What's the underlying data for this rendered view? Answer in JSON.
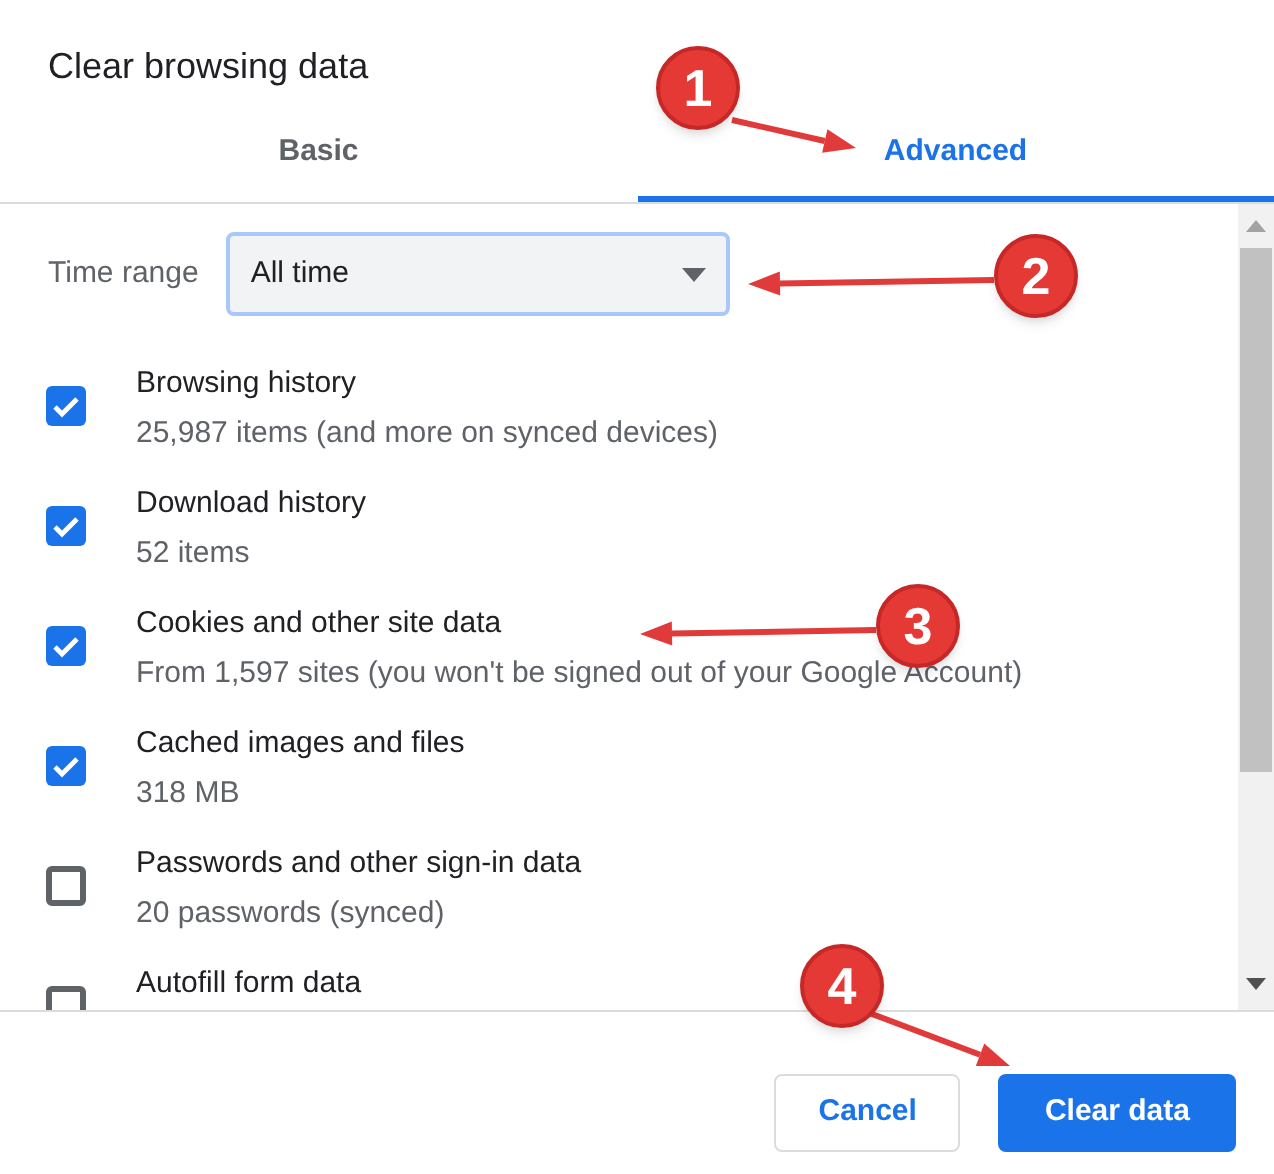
{
  "dialog": {
    "title": "Clear browsing data"
  },
  "tabs": [
    {
      "label": "Basic",
      "selected": false
    },
    {
      "label": "Advanced",
      "selected": true
    }
  ],
  "time_range": {
    "label": "Time range",
    "value": "All time"
  },
  "items": [
    {
      "title": "Browsing history",
      "detail": "25,987 items (and more on synced devices)",
      "checked": true
    },
    {
      "title": "Download history",
      "detail": "52 items",
      "checked": true
    },
    {
      "title": "Cookies and other site data",
      "detail": "From 1,597 sites (you won't be signed out of your Google Account)",
      "checked": true
    },
    {
      "title": "Cached images and files",
      "detail": "318 MB",
      "checked": true
    },
    {
      "title": "Passwords and other sign-in data",
      "detail": "20 passwords (synced)",
      "checked": false
    },
    {
      "title": "Autofill form data",
      "checked": false
    }
  ],
  "buttons": [
    {
      "label": "Cancel",
      "kind": "secondary"
    },
    {
      "label": "Clear data",
      "kind": "primary"
    }
  ],
  "annotations": [
    {
      "label": "1"
    },
    {
      "label": "2"
    },
    {
      "label": "3"
    },
    {
      "label": "4"
    }
  ]
}
